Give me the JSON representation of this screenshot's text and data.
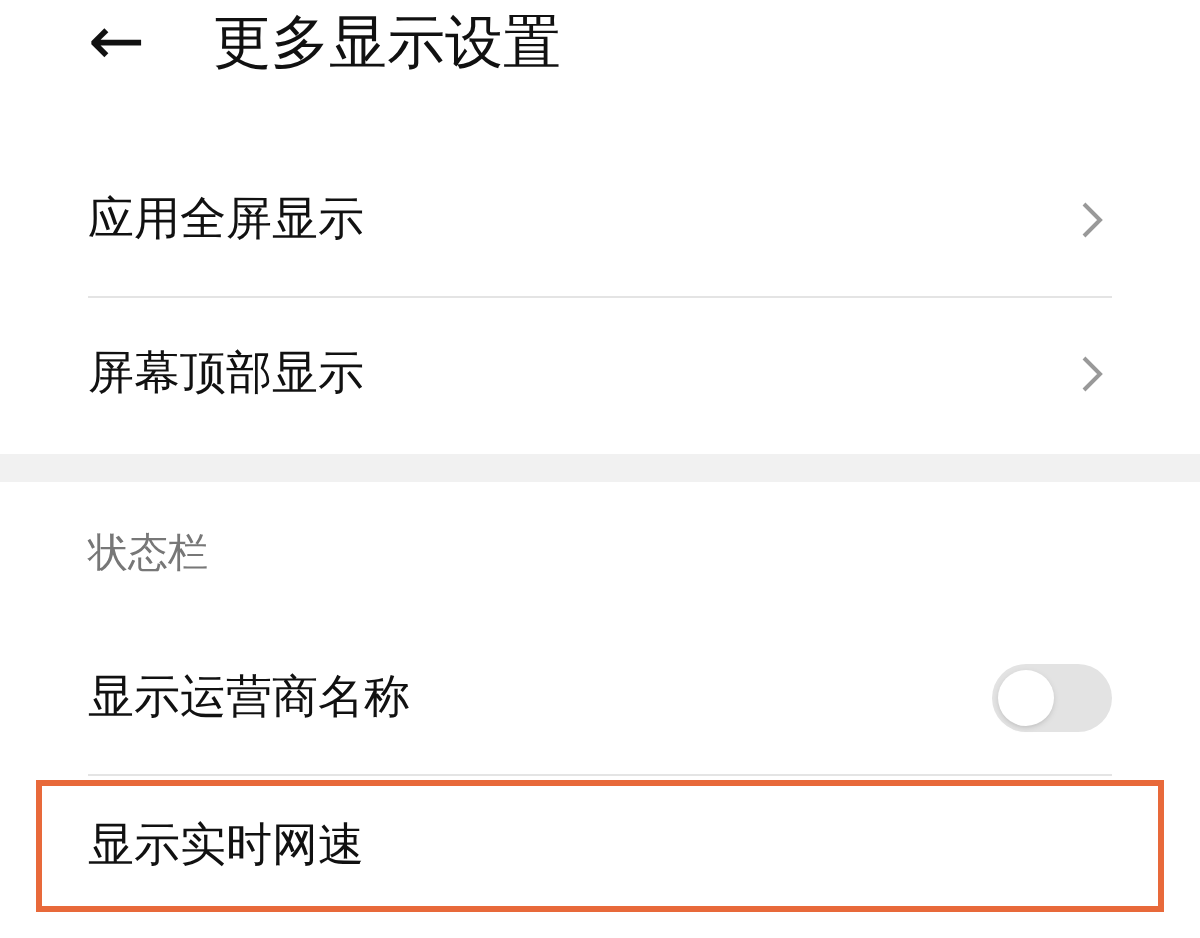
{
  "header": {
    "back": "←",
    "title": "更多显示设置"
  },
  "groups": [
    {
      "items": [
        {
          "kind": "link",
          "label": "应用全屏显示",
          "highlighted": false
        },
        {
          "kind": "link",
          "label": "屏幕顶部显示",
          "highlighted": false
        }
      ]
    },
    {
      "title": "状态栏",
      "items": [
        {
          "kind": "toggle",
          "label": "显示运营商名称",
          "on": false,
          "highlighted": false
        },
        {
          "kind": "plain",
          "label": "显示实时网速",
          "highlighted": true
        }
      ]
    }
  ]
}
